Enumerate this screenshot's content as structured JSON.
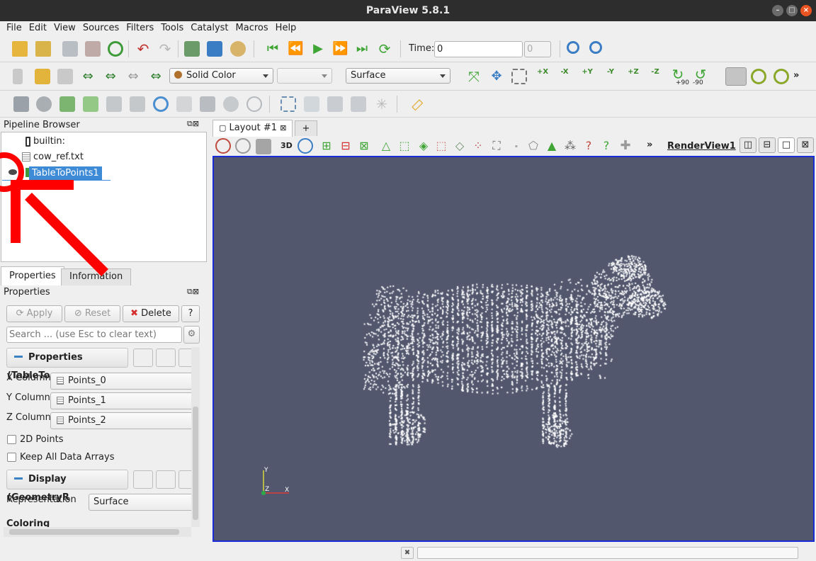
{
  "window": {
    "title": "ParaView 5.8.1"
  },
  "menu": [
    "File",
    "Edit",
    "View",
    "Sources",
    "Filters",
    "Tools",
    "Catalyst",
    "Macros",
    "Help"
  ],
  "time_toolbar": {
    "time_label": "Time:",
    "time_value": "0",
    "step_value": "0"
  },
  "coloring_combo": {
    "value": "Solid Color"
  },
  "component_combo": {
    "value": ""
  },
  "representation_combo": {
    "value": "Surface"
  },
  "axes_buttons": [
    "+X",
    "-X",
    "+Y",
    "-Y",
    "+Z",
    "-Z"
  ],
  "rotate_buttons": [
    "+90",
    "-90"
  ],
  "pipeline": {
    "title": "Pipeline Browser",
    "items": [
      "builtin:",
      "cow_ref.txt",
      "TableToPoints1"
    ]
  },
  "props_tabs": [
    "Properties",
    "Information"
  ],
  "properties": {
    "title": "Properties",
    "apply": "Apply",
    "reset": "Reset",
    "delete": "Delete",
    "help": "?",
    "search_placeholder": "Search ... (use Esc to clear text)",
    "section1": "Properties (TableTo",
    "x_label": "X Column",
    "x_value": "Points_0",
    "y_label": "Y Column",
    "y_value": "Points_1",
    "z_label": "Z Column",
    "z_value": "Points_2",
    "points2d": "2D Points",
    "keep_arrays": "Keep All Data Arrays",
    "section2": "Display (GeometryR",
    "rep_label": "Representation",
    "rep_value": "Surface",
    "coloring": "Coloring"
  },
  "layout": {
    "tab": "Layout #1",
    "add_tab": "+",
    "view_name": "RenderView1",
    "mode_3d": "3D",
    "more": "»"
  },
  "axes_triad": {
    "y": "Y",
    "z": "Z",
    "x": "X"
  },
  "colors": {
    "render_bg": "#52576e",
    "selection": "#3d8ad6",
    "annotation": "#ff0000"
  }
}
